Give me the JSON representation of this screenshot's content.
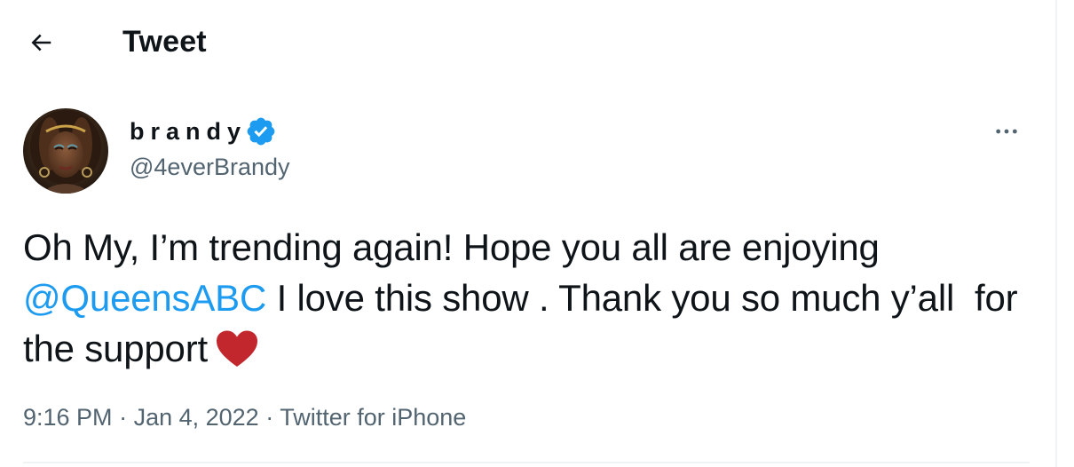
{
  "header": {
    "back_icon": "arrow-left-icon",
    "title": "Tweet"
  },
  "author": {
    "display_name": "brandy",
    "verified_icon": "verified-badge-icon",
    "verified_color": "#1d9bf0",
    "handle": "@4everBrandy"
  },
  "more_icon": "more-options-icon",
  "tweet": {
    "text_part1": "Oh My, I’m trending again! Hope you all are enjoying ",
    "mention": "@QueensABC",
    "text_part2": " I love this show . Thank you so much y’all  for the support",
    "heart_icon": "heart-emoji-icon",
    "heart_color": "#c1272d"
  },
  "meta": {
    "time": "9:16 PM",
    "separator": " · ",
    "date": "Jan 4, 2022",
    "source": "Twitter for iPhone"
  },
  "colors": {
    "text": "#0f1419",
    "secondary": "#536471",
    "link": "#1d9bf0",
    "border": "#eff3f4"
  }
}
